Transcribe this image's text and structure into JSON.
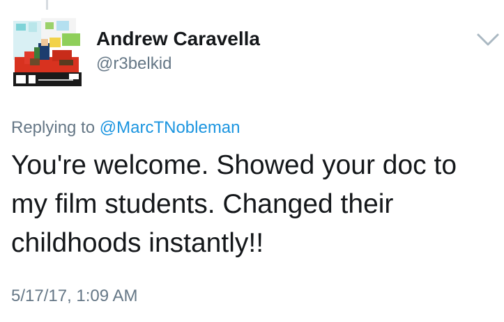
{
  "tweet": {
    "author": {
      "display_name": "Andrew Caravella",
      "handle": "@r3belkid",
      "avatar_icon": "album-art-avatar"
    },
    "reply_prefix": "Replying to",
    "reply_to": "@MarcTNobleman",
    "text": "You're welcome. Showed your doc to my film students. Changed their childhoods instantly!!",
    "timestamp": "5/17/17, 1:09 AM",
    "menu_icon": "chevron-down-icon"
  },
  "colors": {
    "text_primary": "#14171a",
    "text_secondary": "#657786",
    "link": "#1b95e0",
    "chevron": "#aab8c2",
    "thread_line": "#d6dbe0"
  }
}
